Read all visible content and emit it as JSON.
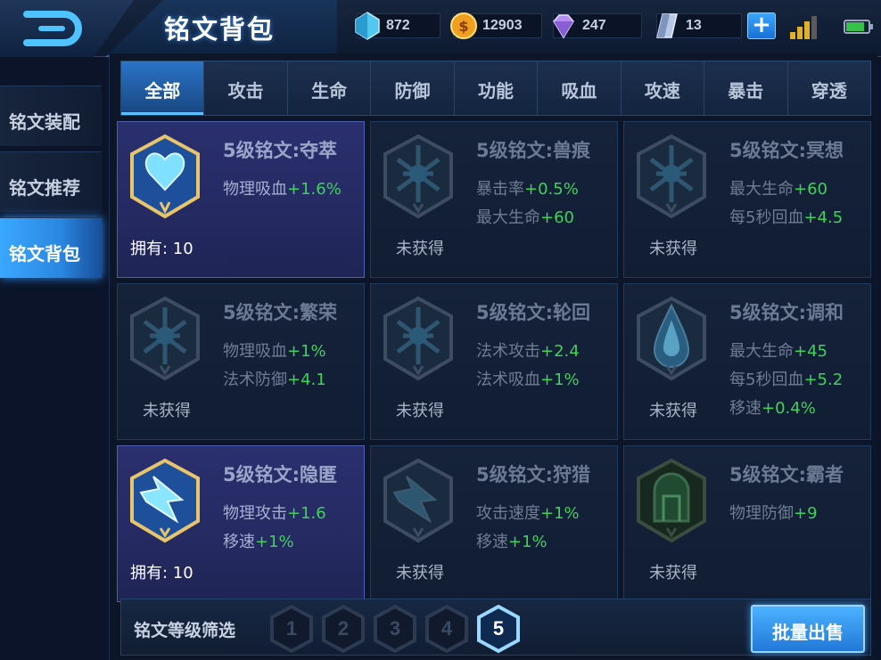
{
  "header": {
    "title": "铭文背包",
    "currencies": [
      {
        "icon": "diamond-icon",
        "value": "872"
      },
      {
        "icon": "gold-coin-icon",
        "value": "12903"
      },
      {
        "icon": "purple-gem-icon",
        "value": "247"
      },
      {
        "icon": "silver-crystal-icon",
        "value": "13"
      }
    ]
  },
  "sidebar": {
    "items": [
      {
        "label": "铭文装配"
      },
      {
        "label": "铭文推荐"
      },
      {
        "label": "铭文背包"
      }
    ],
    "active_index": 2
  },
  "tabs": {
    "items": [
      "全部",
      "攻击",
      "生命",
      "防御",
      "功能",
      "吸血",
      "攻速",
      "暴击",
      "穿透"
    ],
    "active_index": 0
  },
  "cards": [
    {
      "name": "5级铭文:夺萃",
      "owned": true,
      "status": "拥有: 10",
      "gem": "blue-heart",
      "attrs": [
        {
          "label": "物理吸血",
          "value": "+1.6%"
        }
      ]
    },
    {
      "name": "5级铭文:兽痕",
      "owned": false,
      "status": "未获得",
      "gem": "blue-web",
      "attrs": [
        {
          "label": "暴击率",
          "value": "+0.5%"
        },
        {
          "label": "最大生命",
          "value": "+60"
        }
      ]
    },
    {
      "name": "5级铭文:冥想",
      "owned": false,
      "status": "未获得",
      "gem": "blue-web",
      "attrs": [
        {
          "label": "最大生命",
          "value": "+60"
        },
        {
          "label": "每5秒回血",
          "value": "+4.5"
        }
      ]
    },
    {
      "name": "5级铭文:繁荣",
      "owned": false,
      "status": "未获得",
      "gem": "blue-web",
      "attrs": [
        {
          "label": "物理吸血",
          "value": "+1%"
        },
        {
          "label": "法术防御",
          "value": "+4.1"
        }
      ]
    },
    {
      "name": "5级铭文:轮回",
      "owned": false,
      "status": "未获得",
      "gem": "blue-web",
      "attrs": [
        {
          "label": "法术攻击",
          "value": "+2.4"
        },
        {
          "label": "法术吸血",
          "value": "+1%"
        }
      ]
    },
    {
      "name": "5级铭文:调和",
      "owned": false,
      "status": "未获得",
      "gem": "blue-drop",
      "attrs": [
        {
          "label": "最大生命",
          "value": "+45"
        },
        {
          "label": "每5秒回血",
          "value": "+5.2"
        },
        {
          "label": "移速",
          "value": "+0.4%"
        }
      ]
    },
    {
      "name": "5级铭文:隐匿",
      "owned": true,
      "status": "拥有: 10",
      "gem": "blue-bolt",
      "attrs": [
        {
          "label": "物理攻击",
          "value": "+1.6"
        },
        {
          "label": "移速",
          "value": "+1%"
        }
      ]
    },
    {
      "name": "5级铭文:狩猎",
      "owned": false,
      "status": "未获得",
      "gem": "blue-bolt",
      "attrs": [
        {
          "label": "攻击速度",
          "value": "+1%"
        },
        {
          "label": "移速",
          "value": "+1%"
        }
      ]
    },
    {
      "name": "5级铭文:霸者",
      "owned": false,
      "status": "未获得",
      "gem": "green-gate",
      "attrs": [
        {
          "label": "物理防御",
          "value": "+9"
        }
      ]
    }
  ],
  "filter": {
    "label": "铭文等级筛选",
    "levels": [
      "1",
      "2",
      "3",
      "4",
      "5"
    ],
    "active_index": 4
  },
  "sell_button": {
    "label": "批量出售"
  }
}
